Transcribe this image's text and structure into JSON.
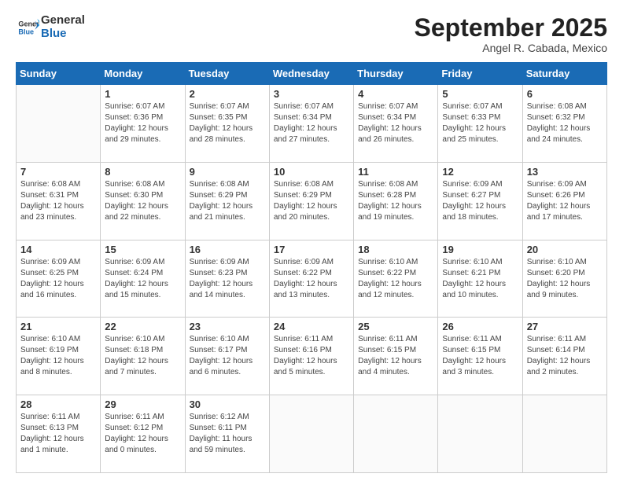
{
  "header": {
    "logo_general": "General",
    "logo_blue": "Blue",
    "month_title": "September 2025",
    "location": "Angel R. Cabada, Mexico"
  },
  "days_of_week": [
    "Sunday",
    "Monday",
    "Tuesday",
    "Wednesday",
    "Thursday",
    "Friday",
    "Saturday"
  ],
  "weeks": [
    [
      {
        "day": "",
        "info": ""
      },
      {
        "day": "1",
        "info": "Sunrise: 6:07 AM\nSunset: 6:36 PM\nDaylight: 12 hours\nand 29 minutes."
      },
      {
        "day": "2",
        "info": "Sunrise: 6:07 AM\nSunset: 6:35 PM\nDaylight: 12 hours\nand 28 minutes."
      },
      {
        "day": "3",
        "info": "Sunrise: 6:07 AM\nSunset: 6:34 PM\nDaylight: 12 hours\nand 27 minutes."
      },
      {
        "day": "4",
        "info": "Sunrise: 6:07 AM\nSunset: 6:34 PM\nDaylight: 12 hours\nand 26 minutes."
      },
      {
        "day": "5",
        "info": "Sunrise: 6:07 AM\nSunset: 6:33 PM\nDaylight: 12 hours\nand 25 minutes."
      },
      {
        "day": "6",
        "info": "Sunrise: 6:08 AM\nSunset: 6:32 PM\nDaylight: 12 hours\nand 24 minutes."
      }
    ],
    [
      {
        "day": "7",
        "info": "Sunrise: 6:08 AM\nSunset: 6:31 PM\nDaylight: 12 hours\nand 23 minutes."
      },
      {
        "day": "8",
        "info": "Sunrise: 6:08 AM\nSunset: 6:30 PM\nDaylight: 12 hours\nand 22 minutes."
      },
      {
        "day": "9",
        "info": "Sunrise: 6:08 AM\nSunset: 6:29 PM\nDaylight: 12 hours\nand 21 minutes."
      },
      {
        "day": "10",
        "info": "Sunrise: 6:08 AM\nSunset: 6:29 PM\nDaylight: 12 hours\nand 20 minutes."
      },
      {
        "day": "11",
        "info": "Sunrise: 6:08 AM\nSunset: 6:28 PM\nDaylight: 12 hours\nand 19 minutes."
      },
      {
        "day": "12",
        "info": "Sunrise: 6:09 AM\nSunset: 6:27 PM\nDaylight: 12 hours\nand 18 minutes."
      },
      {
        "day": "13",
        "info": "Sunrise: 6:09 AM\nSunset: 6:26 PM\nDaylight: 12 hours\nand 17 minutes."
      }
    ],
    [
      {
        "day": "14",
        "info": "Sunrise: 6:09 AM\nSunset: 6:25 PM\nDaylight: 12 hours\nand 16 minutes."
      },
      {
        "day": "15",
        "info": "Sunrise: 6:09 AM\nSunset: 6:24 PM\nDaylight: 12 hours\nand 15 minutes."
      },
      {
        "day": "16",
        "info": "Sunrise: 6:09 AM\nSunset: 6:23 PM\nDaylight: 12 hours\nand 14 minutes."
      },
      {
        "day": "17",
        "info": "Sunrise: 6:09 AM\nSunset: 6:22 PM\nDaylight: 12 hours\nand 13 minutes."
      },
      {
        "day": "18",
        "info": "Sunrise: 6:10 AM\nSunset: 6:22 PM\nDaylight: 12 hours\nand 12 minutes."
      },
      {
        "day": "19",
        "info": "Sunrise: 6:10 AM\nSunset: 6:21 PM\nDaylight: 12 hours\nand 10 minutes."
      },
      {
        "day": "20",
        "info": "Sunrise: 6:10 AM\nSunset: 6:20 PM\nDaylight: 12 hours\nand 9 minutes."
      }
    ],
    [
      {
        "day": "21",
        "info": "Sunrise: 6:10 AM\nSunset: 6:19 PM\nDaylight: 12 hours\nand 8 minutes."
      },
      {
        "day": "22",
        "info": "Sunrise: 6:10 AM\nSunset: 6:18 PM\nDaylight: 12 hours\nand 7 minutes."
      },
      {
        "day": "23",
        "info": "Sunrise: 6:10 AM\nSunset: 6:17 PM\nDaylight: 12 hours\nand 6 minutes."
      },
      {
        "day": "24",
        "info": "Sunrise: 6:11 AM\nSunset: 6:16 PM\nDaylight: 12 hours\nand 5 minutes."
      },
      {
        "day": "25",
        "info": "Sunrise: 6:11 AM\nSunset: 6:15 PM\nDaylight: 12 hours\nand 4 minutes."
      },
      {
        "day": "26",
        "info": "Sunrise: 6:11 AM\nSunset: 6:15 PM\nDaylight: 12 hours\nand 3 minutes."
      },
      {
        "day": "27",
        "info": "Sunrise: 6:11 AM\nSunset: 6:14 PM\nDaylight: 12 hours\nand 2 minutes."
      }
    ],
    [
      {
        "day": "28",
        "info": "Sunrise: 6:11 AM\nSunset: 6:13 PM\nDaylight: 12 hours\nand 1 minute."
      },
      {
        "day": "29",
        "info": "Sunrise: 6:11 AM\nSunset: 6:12 PM\nDaylight: 12 hours\nand 0 minutes."
      },
      {
        "day": "30",
        "info": "Sunrise: 6:12 AM\nSunset: 6:11 PM\nDaylight: 11 hours\nand 59 minutes."
      },
      {
        "day": "",
        "info": ""
      },
      {
        "day": "",
        "info": ""
      },
      {
        "day": "",
        "info": ""
      },
      {
        "day": "",
        "info": ""
      }
    ]
  ]
}
